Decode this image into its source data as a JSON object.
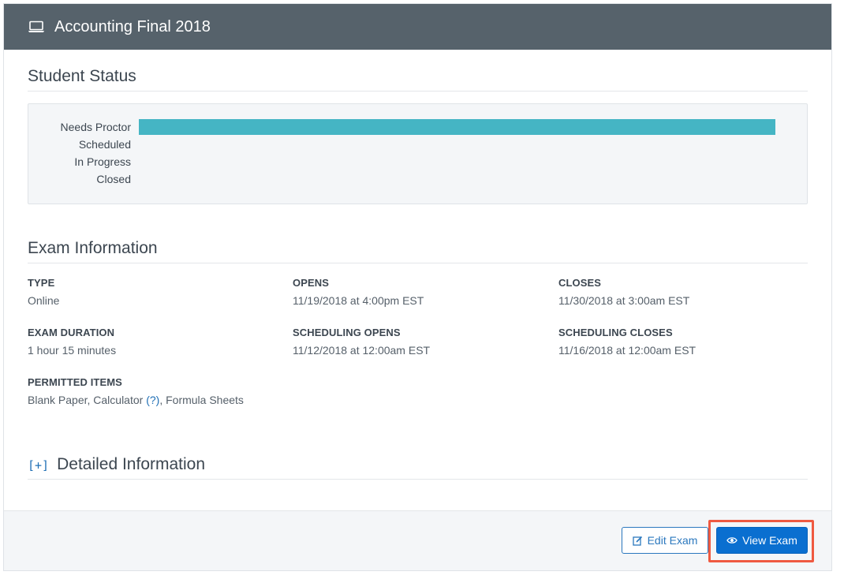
{
  "header": {
    "title": "Accounting Final 2018",
    "icon": "laptop-icon"
  },
  "student_status": {
    "title": "Student Status",
    "rows": [
      {
        "label": "Needs Proctor",
        "fraction": 1.0
      },
      {
        "label": "Scheduled",
        "fraction": 0
      },
      {
        "label": "In Progress",
        "fraction": 0
      },
      {
        "label": "Closed",
        "fraction": 0
      }
    ],
    "bar_color": "#45b5c4"
  },
  "exam_info": {
    "title": "Exam Information",
    "type_label": "TYPE",
    "type_value": "Online",
    "opens_label": "OPENS",
    "opens_value": "11/19/2018 at 4:00pm EST",
    "closes_label": "CLOSES",
    "closes_value": "11/30/2018 at 3:00am EST",
    "duration_label": "EXAM DURATION",
    "duration_value": "1 hour 15 minutes",
    "sched_opens_label": "SCHEDULING OPENS",
    "sched_opens_value": "11/12/2018 at 12:00am EST",
    "sched_closes_label": "SCHEDULING CLOSES",
    "sched_closes_value": "11/16/2018 at 12:00am EST",
    "permitted_label": "PERMITTED ITEMS",
    "permitted_item_1": "Blank Paper,",
    "permitted_item_2": "Calculator",
    "permitted_help": "(?)",
    "permitted_item_3": ", Formula Sheets"
  },
  "detailed": {
    "toggle": "[+]",
    "title": "Detailed Information"
  },
  "footer": {
    "edit_label": "Edit Exam",
    "view_label": "View Exam",
    "primary_color": "#0a6fd0",
    "highlight_color": "#ef5a41"
  }
}
